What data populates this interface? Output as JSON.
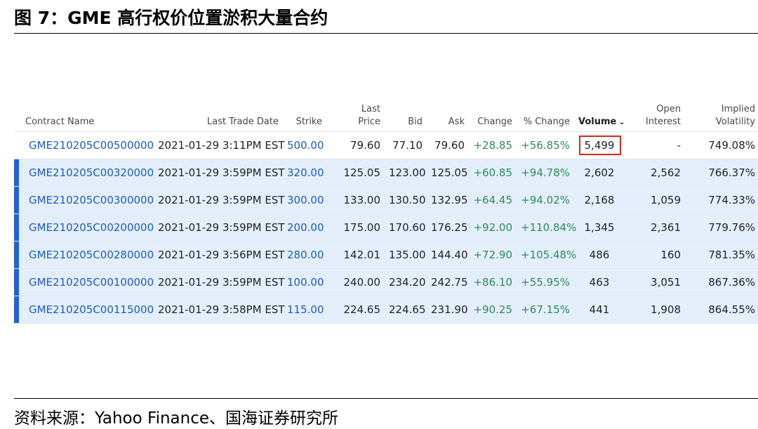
{
  "figure": {
    "title": "图 7：GME 高行权价位置淤积大量合约",
    "source": "资料来源：Yahoo Finance、国海证券研究所"
  },
  "table": {
    "headers": {
      "contract_name": "Contract Name",
      "last_trade_date": "Last Trade Date",
      "strike": "Strike",
      "last_price": "Last\nPrice",
      "bid": "Bid",
      "ask": "Ask",
      "change": "Change",
      "pct_change": "% Change",
      "volume": "Volume",
      "open_interest": "Open\nInterest",
      "implied_volatility": "Implied\nVolatility"
    },
    "rows": [
      {
        "contract": "GME210205C00500000",
        "date": "2021-01-29 3:11PM EST",
        "strike": "500.00",
        "last": "79.60",
        "bid": "77.10",
        "ask": "79.60",
        "change": "+28.85",
        "pct": "+56.85%",
        "volume": "5,499",
        "oi": "-",
        "iv": "749.08%"
      },
      {
        "contract": "GME210205C00320000",
        "date": "2021-01-29 3:59PM EST",
        "strike": "320.00",
        "last": "125.05",
        "bid": "123.00",
        "ask": "125.05",
        "change": "+60.85",
        "pct": "+94.78%",
        "volume": "2,602",
        "oi": "2,562",
        "iv": "766.37%"
      },
      {
        "contract": "GME210205C00300000",
        "date": "2021-01-29 3:59PM EST",
        "strike": "300.00",
        "last": "133.00",
        "bid": "130.50",
        "ask": "132.95",
        "change": "+64.45",
        "pct": "+94.02%",
        "volume": "2,168",
        "oi": "1,059",
        "iv": "774.33%"
      },
      {
        "contract": "GME210205C00200000",
        "date": "2021-01-29 3:59PM EST",
        "strike": "200.00",
        "last": "175.00",
        "bid": "170.60",
        "ask": "176.25",
        "change": "+92.00",
        "pct": "+110.84%",
        "volume": "1,345",
        "oi": "2,361",
        "iv": "779.76%"
      },
      {
        "contract": "GME210205C00280000",
        "date": "2021-01-29 3:56PM EST",
        "strike": "280.00",
        "last": "142.01",
        "bid": "135.00",
        "ask": "144.40",
        "change": "+72.90",
        "pct": "+105.48%",
        "volume": "486",
        "oi": "160",
        "iv": "781.35%"
      },
      {
        "contract": "GME210205C00100000",
        "date": "2021-01-29 3:59PM EST",
        "strike": "100.00",
        "last": "240.00",
        "bid": "234.20",
        "ask": "242.75",
        "change": "+86.10",
        "pct": "+55.95%",
        "volume": "463",
        "oi": "3,051",
        "iv": "867.36%"
      },
      {
        "contract": "GME210205C00115000",
        "date": "2021-01-29 3:58PM EST",
        "strike": "115.00",
        "last": "224.65",
        "bid": "224.65",
        "ask": "231.90",
        "change": "+90.25",
        "pct": "+67.15%",
        "volume": "441",
        "oi": "1,908",
        "iv": "864.55%"
      }
    ],
    "highlight_color": "#e4eefb",
    "accent_bar_color": "#1e63d6",
    "link_color": "#1b5bbf",
    "positive_color": "#2e8b57",
    "callout_box_color": "#d9261c",
    "sort_icon": "chevron-down-icon"
  }
}
